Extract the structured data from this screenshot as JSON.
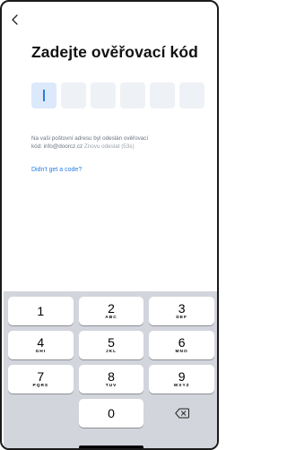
{
  "screen": {
    "title": "Zadejte ověřovací kód",
    "code_length": 6,
    "info_line1": "Na vaši poštovní adresu byl odeslán ověřovací",
    "info_line2_prefix": "kód: info@doorcz.cz",
    "resend_text": "Znovu odeslat (53s)",
    "didnt_get_code": "Didn't get a code?"
  },
  "keypad": {
    "keys": [
      {
        "digit": "1",
        "letters": ""
      },
      {
        "digit": "2",
        "letters": "ABC"
      },
      {
        "digit": "3",
        "letters": "DEF"
      },
      {
        "digit": "4",
        "letters": "GHI"
      },
      {
        "digit": "5",
        "letters": "JKL"
      },
      {
        "digit": "6",
        "letters": "MNO"
      },
      {
        "digit": "7",
        "letters": "PQRS"
      },
      {
        "digit": "8",
        "letters": "TUV"
      },
      {
        "digit": "9",
        "letters": "WXYZ"
      },
      {
        "digit": "0",
        "letters": ""
      }
    ],
    "delete_icon": "backspace-icon"
  },
  "colors": {
    "accent": "#2a7de1",
    "box_empty": "#eef1f5",
    "box_active": "#dce9fb",
    "keypad_bg": "#d2d5db"
  }
}
